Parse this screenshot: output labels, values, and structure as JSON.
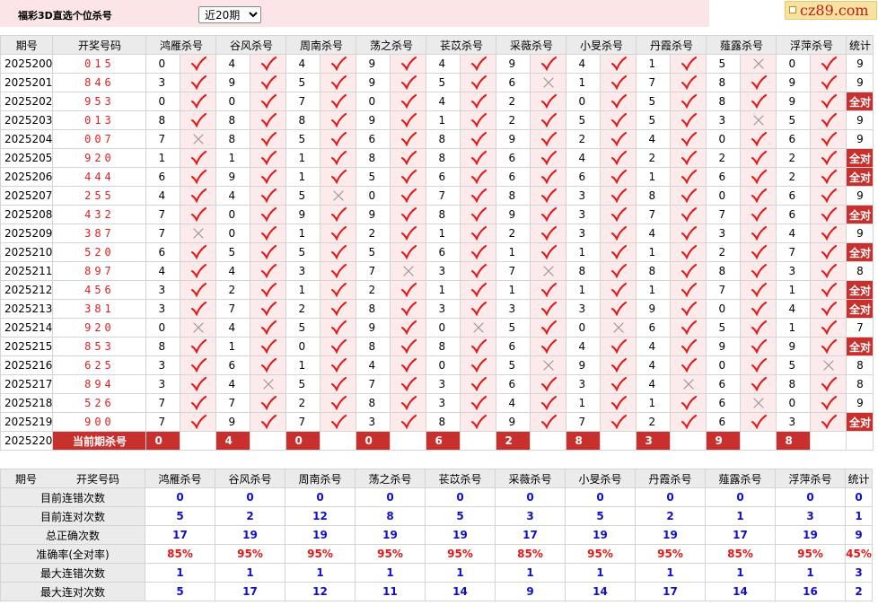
{
  "page": {
    "title": "福彩3D直选个位杀号",
    "period_select": "近20期",
    "logo": "cz89.com"
  },
  "headers": [
    "期号",
    "开奖号码",
    "鸿雁杀号",
    "谷风杀号",
    "周南杀号",
    "荡之杀号",
    "苌苡杀号",
    "采薇杀号",
    "小旻杀号",
    "丹霞杀号",
    "薤露杀号",
    "浮萍杀号",
    "统计"
  ],
  "rows": [
    {
      "period": "2025200",
      "draw": "015",
      "kills": [
        0,
        4,
        4,
        9,
        4,
        9,
        4,
        1,
        5,
        0
      ],
      "marks": [
        "ok",
        "ok",
        "ok",
        "ok",
        "ok",
        "ok",
        "ok",
        "ok",
        "x",
        "ok"
      ],
      "stat": "9"
    },
    {
      "period": "2025201",
      "draw": "846",
      "kills": [
        3,
        9,
        5,
        9,
        5,
        6,
        1,
        7,
        8,
        9
      ],
      "marks": [
        "ok",
        "ok",
        "ok",
        "ok",
        "ok",
        "x",
        "ok",
        "ok",
        "ok",
        "ok"
      ],
      "stat": "9"
    },
    {
      "period": "2025202",
      "draw": "953",
      "kills": [
        0,
        0,
        7,
        0,
        4,
        2,
        0,
        5,
        8,
        9
      ],
      "marks": [
        "ok",
        "ok",
        "ok",
        "ok",
        "ok",
        "ok",
        "ok",
        "ok",
        "ok",
        "ok"
      ],
      "stat": "全对"
    },
    {
      "period": "2025203",
      "draw": "013",
      "kills": [
        8,
        8,
        8,
        9,
        1,
        2,
        5,
        5,
        3,
        5
      ],
      "marks": [
        "ok",
        "ok",
        "ok",
        "ok",
        "ok",
        "ok",
        "ok",
        "ok",
        "x",
        "ok"
      ],
      "stat": "9"
    },
    {
      "period": "2025204",
      "draw": "007",
      "kills": [
        7,
        8,
        5,
        6,
        8,
        9,
        2,
        4,
        0,
        6
      ],
      "marks": [
        "x",
        "ok",
        "ok",
        "ok",
        "ok",
        "ok",
        "ok",
        "ok",
        "ok",
        "ok"
      ],
      "stat": "9"
    },
    {
      "period": "2025205",
      "draw": "920",
      "kills": [
        1,
        1,
        1,
        8,
        8,
        6,
        4,
        2,
        2,
        2
      ],
      "marks": [
        "ok",
        "ok",
        "ok",
        "ok",
        "ok",
        "ok",
        "ok",
        "ok",
        "ok",
        "ok"
      ],
      "stat": "全对"
    },
    {
      "period": "2025206",
      "draw": "444",
      "kills": [
        6,
        9,
        1,
        5,
        6,
        6,
        6,
        1,
        6,
        2
      ],
      "marks": [
        "ok",
        "ok",
        "ok",
        "ok",
        "ok",
        "ok",
        "ok",
        "ok",
        "ok",
        "ok"
      ],
      "stat": "全对"
    },
    {
      "period": "2025207",
      "draw": "255",
      "kills": [
        4,
        4,
        5,
        0,
        7,
        8,
        3,
        8,
        0,
        6
      ],
      "marks": [
        "ok",
        "ok",
        "x",
        "ok",
        "ok",
        "ok",
        "ok",
        "ok",
        "ok",
        "ok"
      ],
      "stat": "9"
    },
    {
      "period": "2025208",
      "draw": "432",
      "kills": [
        7,
        0,
        9,
        9,
        8,
        9,
        3,
        7,
        7,
        6
      ],
      "marks": [
        "ok",
        "ok",
        "ok",
        "ok",
        "ok",
        "ok",
        "ok",
        "ok",
        "ok",
        "ok"
      ],
      "stat": "全对"
    },
    {
      "period": "2025209",
      "draw": "387",
      "kills": [
        7,
        0,
        1,
        2,
        1,
        2,
        3,
        4,
        3,
        4
      ],
      "marks": [
        "x",
        "ok",
        "ok",
        "ok",
        "ok",
        "ok",
        "ok",
        "ok",
        "ok",
        "ok"
      ],
      "stat": "9"
    },
    {
      "period": "2025210",
      "draw": "520",
      "kills": [
        6,
        5,
        5,
        5,
        6,
        1,
        1,
        1,
        2,
        7
      ],
      "marks": [
        "ok",
        "ok",
        "ok",
        "ok",
        "ok",
        "ok",
        "ok",
        "ok",
        "ok",
        "ok"
      ],
      "stat": "全对"
    },
    {
      "period": "2025211",
      "draw": "897",
      "kills": [
        4,
        4,
        3,
        7,
        3,
        7,
        8,
        8,
        8,
        3
      ],
      "marks": [
        "ok",
        "ok",
        "ok",
        "x",
        "ok",
        "x",
        "ok",
        "ok",
        "ok",
        "ok"
      ],
      "stat": "8"
    },
    {
      "period": "2025212",
      "draw": "456",
      "kills": [
        3,
        2,
        1,
        2,
        1,
        1,
        1,
        1,
        7,
        1
      ],
      "marks": [
        "ok",
        "ok",
        "ok",
        "ok",
        "ok",
        "ok",
        "ok",
        "ok",
        "ok",
        "ok"
      ],
      "stat": "全对"
    },
    {
      "period": "2025213",
      "draw": "381",
      "kills": [
        3,
        7,
        2,
        8,
        3,
        3,
        3,
        9,
        0,
        4
      ],
      "marks": [
        "ok",
        "ok",
        "ok",
        "ok",
        "ok",
        "ok",
        "ok",
        "ok",
        "ok",
        "ok"
      ],
      "stat": "全对"
    },
    {
      "period": "2025214",
      "draw": "920",
      "kills": [
        0,
        4,
        5,
        9,
        0,
        5,
        0,
        6,
        5,
        1
      ],
      "marks": [
        "x",
        "ok",
        "ok",
        "ok",
        "x",
        "ok",
        "x",
        "ok",
        "ok",
        "ok"
      ],
      "stat": "7"
    },
    {
      "period": "2025215",
      "draw": "853",
      "kills": [
        8,
        1,
        0,
        8,
        8,
        6,
        4,
        4,
        9,
        9
      ],
      "marks": [
        "ok",
        "ok",
        "ok",
        "ok",
        "ok",
        "ok",
        "ok",
        "ok",
        "ok",
        "ok"
      ],
      "stat": "全对"
    },
    {
      "period": "2025216",
      "draw": "625",
      "kills": [
        3,
        6,
        1,
        4,
        0,
        5,
        9,
        4,
        0,
        5
      ],
      "marks": [
        "ok",
        "ok",
        "ok",
        "ok",
        "ok",
        "x",
        "ok",
        "ok",
        "ok",
        "x"
      ],
      "stat": "8"
    },
    {
      "period": "2025217",
      "draw": "894",
      "kills": [
        3,
        4,
        5,
        7,
        3,
        6,
        3,
        4,
        6,
        8
      ],
      "marks": [
        "ok",
        "x",
        "ok",
        "ok",
        "ok",
        "ok",
        "ok",
        "x",
        "ok",
        "ok"
      ],
      "stat": "8"
    },
    {
      "period": "2025218",
      "draw": "526",
      "kills": [
        7,
        7,
        2,
        8,
        3,
        4,
        1,
        1,
        6,
        0
      ],
      "marks": [
        "ok",
        "ok",
        "ok",
        "ok",
        "ok",
        "ok",
        "ok",
        "ok",
        "x",
        "ok"
      ],
      "stat": "9"
    },
    {
      "period": "2025219",
      "draw": "900",
      "kills": [
        7,
        9,
        7,
        3,
        8,
        9,
        7,
        2,
        6,
        3
      ],
      "marks": [
        "ok",
        "ok",
        "ok",
        "ok",
        "ok",
        "ok",
        "ok",
        "ok",
        "ok",
        "ok"
      ],
      "stat": "全对"
    }
  ],
  "current": {
    "period": "2025220",
    "label": "当前期杀号",
    "kills": [
      0,
      4,
      0,
      0,
      6,
      2,
      8,
      3,
      9,
      8
    ]
  },
  "summary": [
    {
      "label": "目前连错次数",
      "color": "blue",
      "values": [
        "0",
        "0",
        "0",
        "0",
        "0",
        "0",
        "0",
        "0",
        "0",
        "0"
      ],
      "stat": "0"
    },
    {
      "label": "目前连对次数",
      "color": "blue",
      "values": [
        "5",
        "2",
        "12",
        "8",
        "5",
        "3",
        "5",
        "2",
        "1",
        "3"
      ],
      "stat": "1"
    },
    {
      "label": "总正确次数",
      "color": "blue",
      "values": [
        "17",
        "19",
        "19",
        "19",
        "19",
        "17",
        "19",
        "19",
        "17",
        "19"
      ],
      "stat": "9"
    },
    {
      "label": "准确率(全对率)",
      "color": "red",
      "values": [
        "85%",
        "95%",
        "95%",
        "95%",
        "95%",
        "85%",
        "95%",
        "95%",
        "85%",
        "95%"
      ],
      "stat": "45%"
    },
    {
      "label": "最大连错次数",
      "color": "blue",
      "values": [
        "1",
        "1",
        "1",
        "1",
        "1",
        "1",
        "1",
        "1",
        "1",
        "1"
      ],
      "stat": "3"
    },
    {
      "label": "最大连对次数",
      "color": "blue",
      "values": [
        "5",
        "17",
        "12",
        "11",
        "14",
        "9",
        "14",
        "17",
        "14",
        "16"
      ],
      "stat": "2"
    }
  ],
  "colors": {
    "check": "#e01818",
    "cross": "#999999",
    "accent": "#c8302e",
    "blue": "#1010c8",
    "header_bg": "#ebebeb",
    "mark_bg": "#fdeaea",
    "topbar_bg": "#fbe5e6"
  },
  "icons": {
    "ok": "check-icon",
    "x": "cross-icon"
  }
}
